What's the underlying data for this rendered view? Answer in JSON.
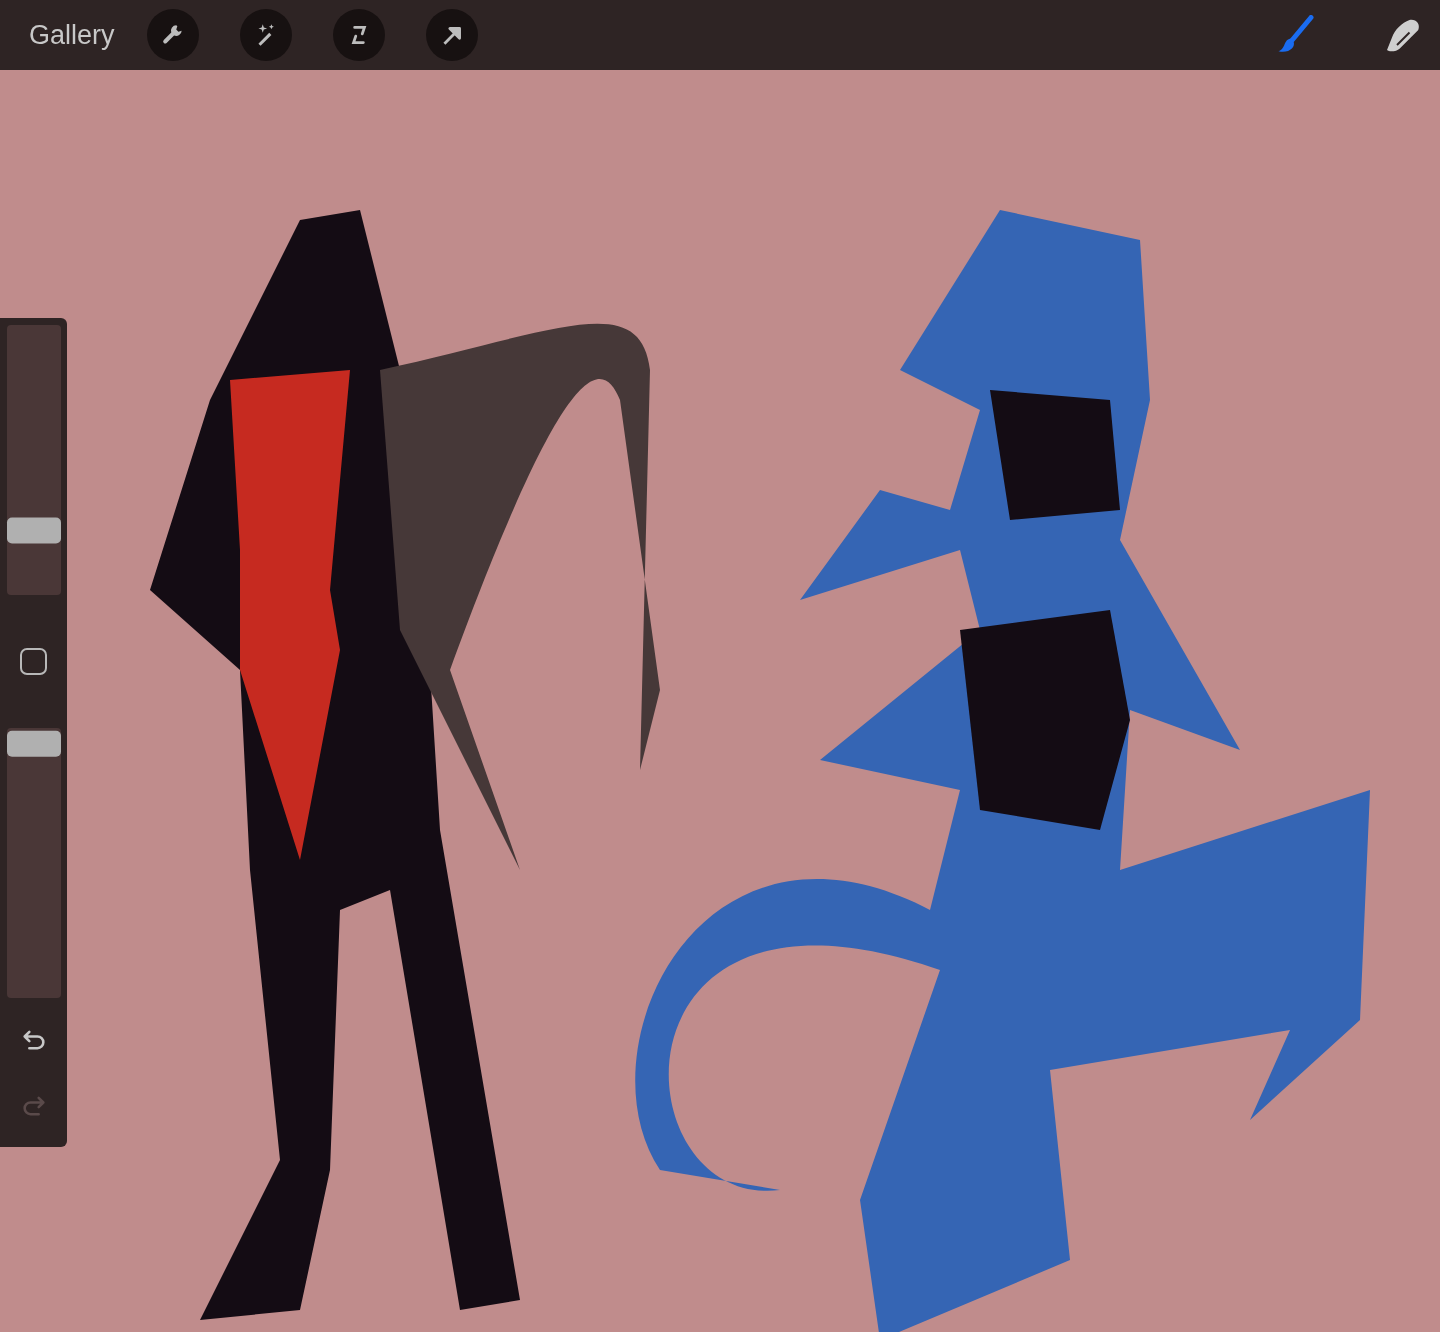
{
  "toolbar": {
    "gallery": "Gallery",
    "tools": [
      {
        "kind": "wrench"
      },
      {
        "kind": "wand"
      },
      {
        "kind": "selection"
      },
      {
        "kind": "arrow"
      }
    ],
    "brushes": [
      {
        "kind": "brush",
        "selected": true
      },
      {
        "kind": "smudge",
        "selected": false
      }
    ]
  },
  "sidebar": {
    "size_slider": {
      "level": 0.21
    },
    "opacity_slider": {
      "level": 0.99
    },
    "undo": {
      "disabled": false
    },
    "redo": {
      "disabled": true
    }
  }
}
